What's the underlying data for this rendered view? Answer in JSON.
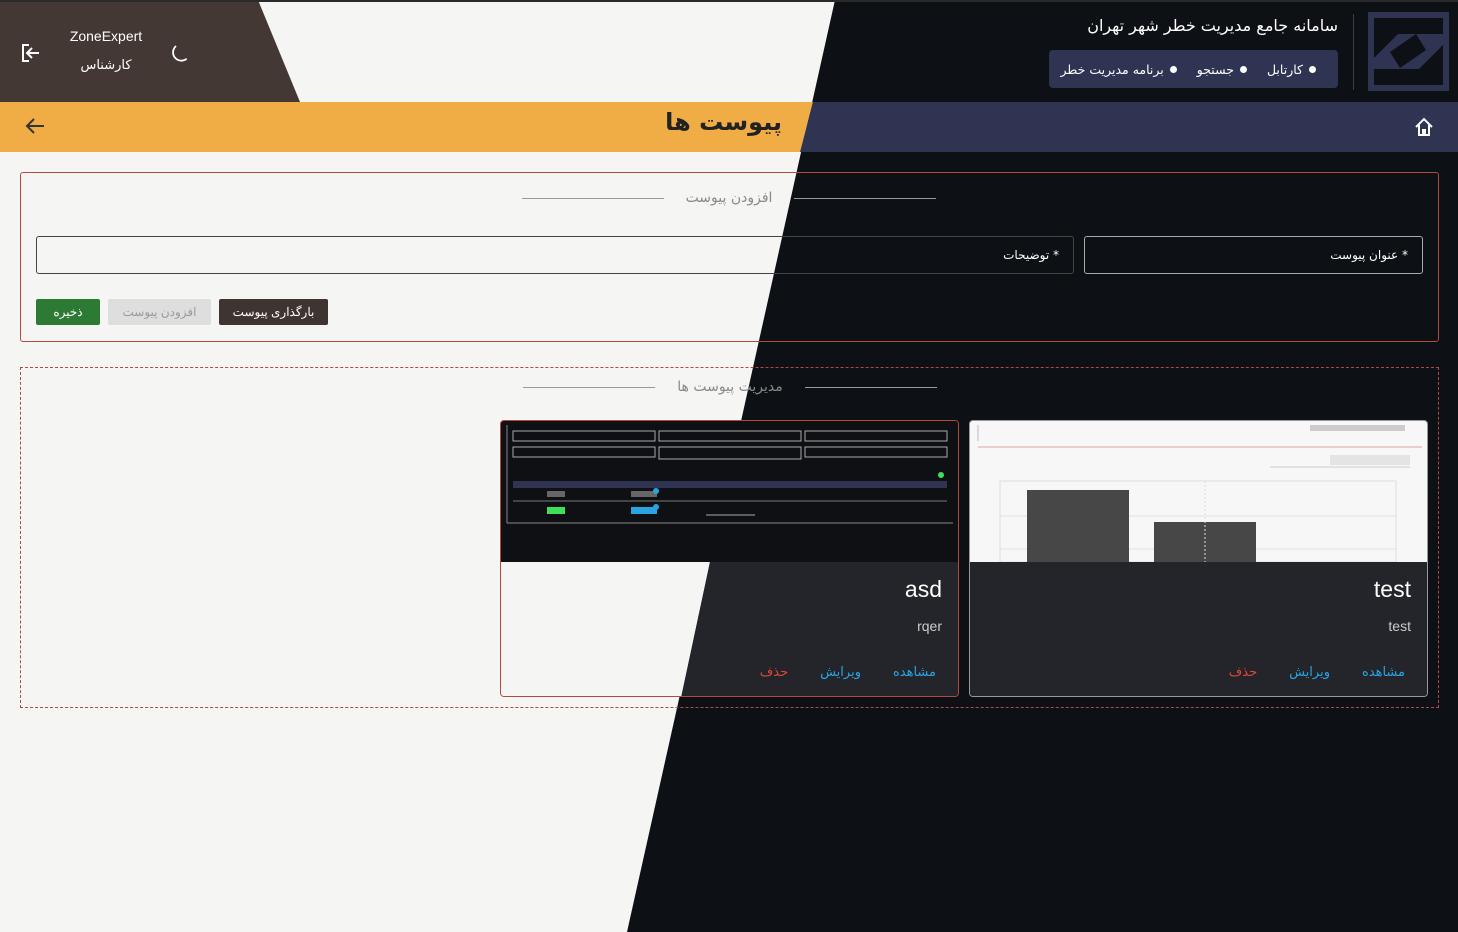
{
  "user": {
    "name": "ZoneExpert",
    "role": "کارشناس"
  },
  "app": {
    "title": "سامانه جامع مدیریت خطر شهر تهران"
  },
  "nav": [
    {
      "label": "کارتابل"
    },
    {
      "label": "جستجو"
    },
    {
      "label": "برنامه مدیریت خطر"
    }
  ],
  "page": {
    "title": "پیوست ها"
  },
  "form": {
    "legend": "افزودن پیوست",
    "title_field_label": "* عنوان پیوست",
    "desc_field_label": "* توضیحات",
    "save_label": "ذخیره",
    "add_label": "افزودن پیوست",
    "upload_label": "بارگذاری پیوست"
  },
  "manage": {
    "legend": "مدیریت پیوست ها",
    "cards": [
      {
        "title": "test",
        "description": "test",
        "view": "مشاهده",
        "edit": "ویرایش",
        "delete": "حذف"
      },
      {
        "title": "asd",
        "description": "rqer",
        "view": "مشاهده",
        "edit": "ویرایش",
        "delete": "حذف"
      }
    ]
  },
  "colors": {
    "accent_yellow": "#f0ad45",
    "navy": "#2e3452",
    "user_panel": "#443834",
    "save_green": "#2d7a34",
    "link_blue": "#2aa4e0",
    "delete_red": "#e0453a"
  },
  "icons": [
    "logout-icon",
    "moon-icon",
    "logo-icon",
    "home-icon",
    "back-arrow-icon"
  ]
}
